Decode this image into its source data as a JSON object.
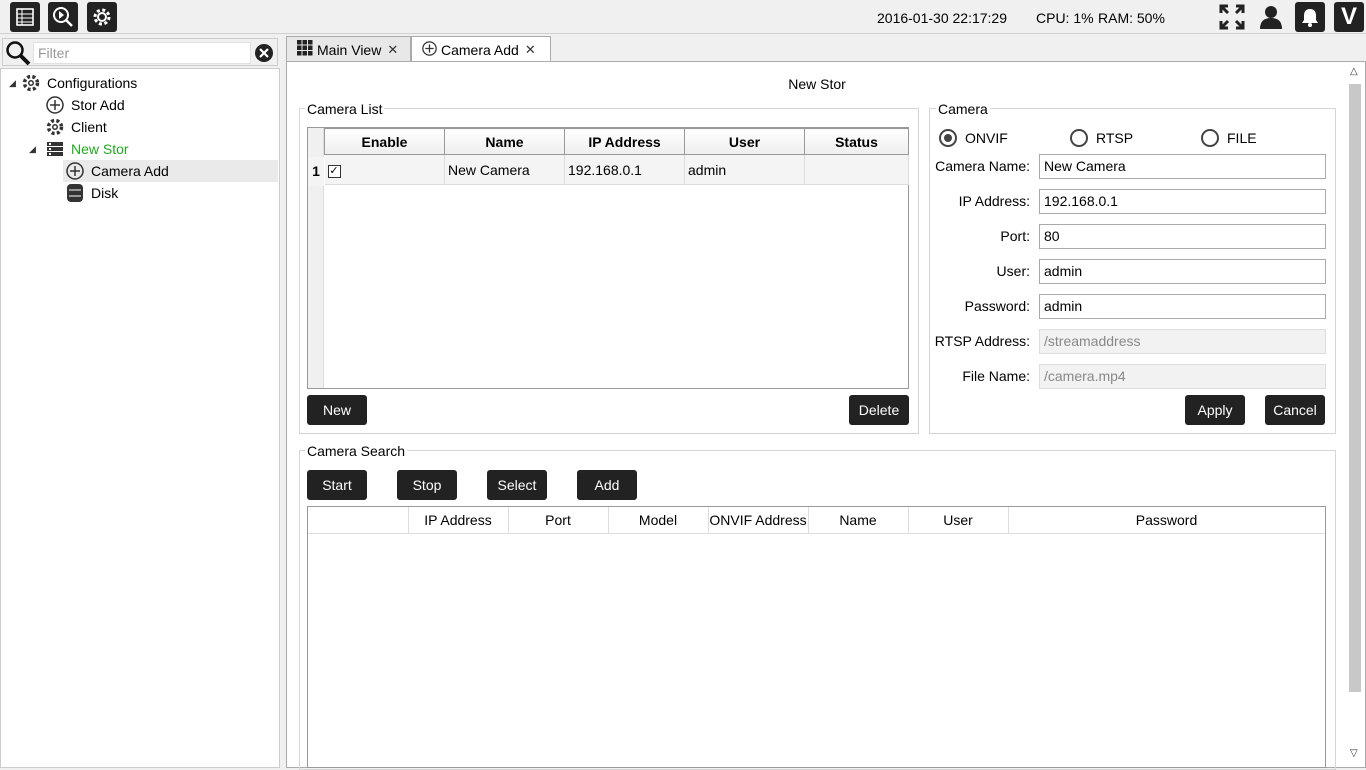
{
  "topbar": {
    "datetime": "2016-01-30 22:17:29",
    "cpu": "CPU: 1%",
    "ram": "RAM: 50%",
    "left_icons": [
      "list-icon",
      "search-play-icon",
      "gear-icon"
    ],
    "right_icons": [
      "fullscreen-icon",
      "user-icon",
      "bell-icon",
      "logo-v-icon"
    ],
    "logo_letter": "V"
  },
  "sidebar": {
    "filter_placeholder": "Filter",
    "tree": [
      {
        "label": "Configurations",
        "icon": "gear-icon",
        "level": 0,
        "expanded": true
      },
      {
        "label": "Stor Add",
        "icon": "plus-circle-icon",
        "level": 1
      },
      {
        "label": "Client",
        "icon": "gear-icon",
        "level": 1
      },
      {
        "label": "New Stor",
        "icon": "server-icon",
        "level": 1,
        "expanded": true,
        "color": "#22aa22"
      },
      {
        "label": "Camera Add",
        "icon": "plus-circle-icon",
        "level": 2,
        "selected": true
      },
      {
        "label": "Disk",
        "icon": "disk-icon",
        "level": 2
      }
    ]
  },
  "tabs": [
    {
      "label": "Main View",
      "icon": "grid-icon",
      "active": false
    },
    {
      "label": "Camera Add",
      "icon": "plus-circle-icon",
      "active": true
    }
  ],
  "main": {
    "page_title": "New Stor",
    "camera_list": {
      "title": "Camera List",
      "columns": [
        "Enable",
        "Name",
        "IP Address",
        "User",
        "Status"
      ],
      "rows": [
        {
          "num": "1",
          "enabled": true,
          "name": "New Camera",
          "ip": "192.168.0.1",
          "user": "admin",
          "status": ""
        }
      ],
      "new_label": "New",
      "delete_label": "Delete"
    },
    "camera": {
      "title": "Camera",
      "radios": [
        "ONVIF",
        "RTSP",
        "FILE"
      ],
      "selected_radio": "ONVIF",
      "labels": {
        "name": "Camera Name:",
        "ip": "IP Address:",
        "port": "Port:",
        "user": "User:",
        "password": "Password:",
        "rtsp": "RTSP Address:",
        "file": "File Name:"
      },
      "values": {
        "name": "New Camera",
        "ip": "192.168.0.1",
        "port": "80",
        "user": "admin",
        "password": "admin",
        "rtsp": "/streamaddress",
        "file": "/camera.mp4"
      },
      "apply_label": "Apply",
      "cancel_label": "Cancel"
    },
    "camera_search": {
      "title": "Camera Search",
      "buttons": [
        "Start",
        "Stop",
        "Select",
        "Add"
      ],
      "columns": [
        "",
        "IP Address",
        "Port",
        "Model",
        "ONVIF Address",
        "Name",
        "User",
        "Password"
      ]
    }
  }
}
